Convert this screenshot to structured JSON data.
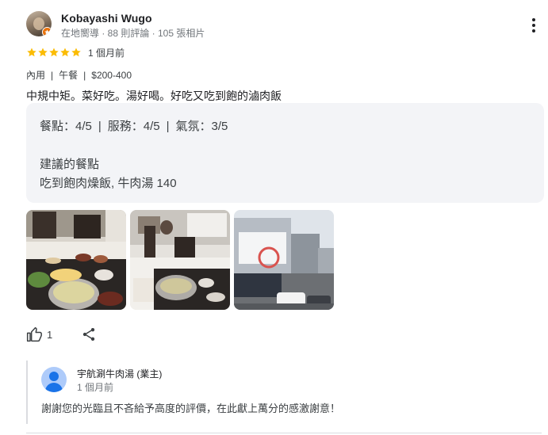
{
  "reviewer": {
    "name": "Kobayashi Wugo",
    "meta": "在地嚮導 · 88 則評論 · 105 張相片",
    "avatar_icon": "user-photo",
    "local_guide_icon": "local-guide-badge-icon"
  },
  "rating": {
    "stars": 5,
    "max_stars": 5,
    "star_color": "#fbbc04",
    "date": "1 個月前"
  },
  "tags": {
    "service": "內用",
    "meal": "午餐",
    "price": "$200-400"
  },
  "review_text": "中規中矩。菜好吃。湯好喝。好吃又吃到飽的滷肉飯",
  "details": {
    "food_label": "餐點：4/5",
    "service_label": "服務：4/5",
    "atmosphere_label": "氣氛：3/5",
    "recommended_title": "建議的餐點",
    "recommended_dishes": "吃到飽肉燥飯, 牛肉湯 140"
  },
  "photos": [
    {
      "alt": "photo-hotpot-meal"
    },
    {
      "alt": "photo-restaurant-interior"
    },
    {
      "alt": "photo-storefront-street"
    }
  ],
  "actions": {
    "like_count": "1",
    "like_icon": "thumbs-up-icon",
    "share_icon": "share-icon"
  },
  "owner_reply": {
    "name": "宇航涮牛肉湯 (業主)",
    "date": "1 個月前",
    "text": "謝謝您的光臨且不吝給予高度的評價，在此獻上萬分的感激謝意！"
  },
  "colors": {
    "accent_blue": "#1a73e8",
    "star": "#fbbc04",
    "local_guide": "#e8710a",
    "detail_bg": "#f3f4f7"
  }
}
